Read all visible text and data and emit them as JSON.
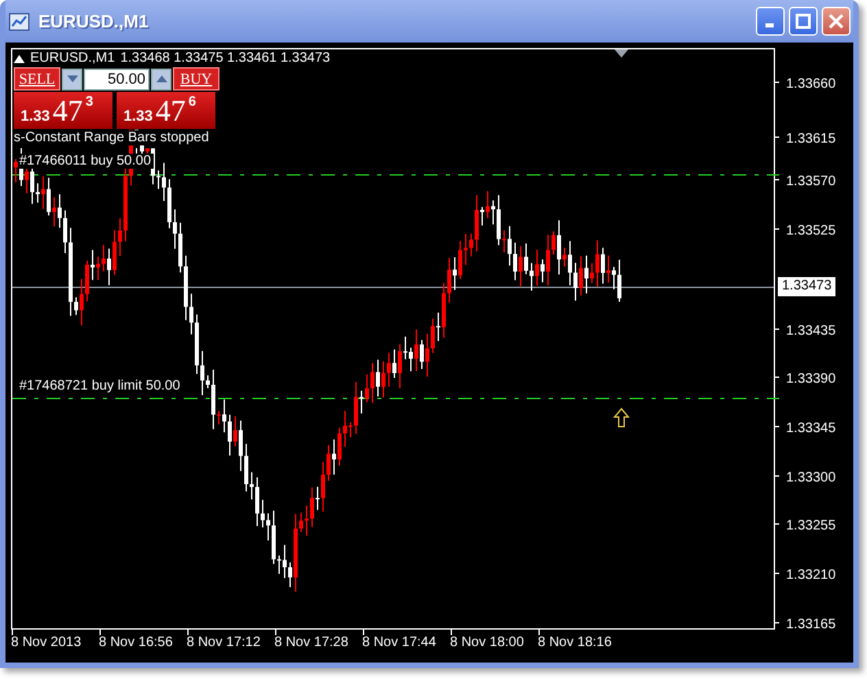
{
  "window": {
    "title": "EURUSD.,M1"
  },
  "chart": {
    "header": {
      "symbol": "EURUSD.,M1",
      "ohlc": "1.33468 1.33475 1.33461 1.33473"
    },
    "trade_panel": {
      "sell_label": "SELL",
      "buy_label": "BUY",
      "lot": "50.00",
      "bid": {
        "prefix": "1.33",
        "big": "47",
        "pip": "3"
      },
      "ask": {
        "prefix": "1.33",
        "big": "47",
        "pip": "6"
      }
    },
    "expert_message": "s-Constant Range Bars stopped",
    "order_lines": [
      {
        "label": "#17466011 buy 50.00"
      },
      {
        "label": "#17468721 buy limit 50.00"
      }
    ],
    "price_axis": {
      "ticks": [
        "1.33660",
        "1.33615",
        "1.33570",
        "1.33525",
        "1.33435",
        "1.33390",
        "1.33345",
        "1.33300",
        "1.33255",
        "1.33210",
        "1.33165"
      ],
      "current": "1.33473"
    },
    "time_axis": {
      "labels": [
        "8 Nov 2013",
        "8 Nov 16:56",
        "8 Nov 17:12",
        "8 Nov 17:28",
        "8 Nov 17:44",
        "8 Nov 18:00",
        "8 Nov 18:16"
      ]
    }
  }
}
